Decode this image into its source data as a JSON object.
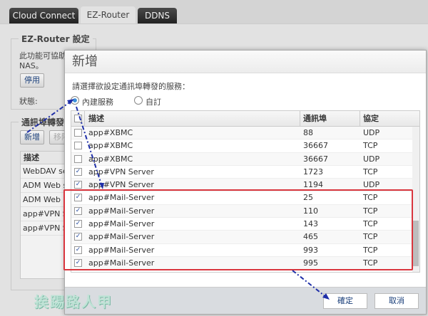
{
  "tabs": [
    {
      "label": "Cloud Connect"
    },
    {
      "label": "EZ-Router"
    },
    {
      "label": "DDNS"
    }
  ],
  "ez": {
    "legend": "EZ-Router 設定",
    "desc_line1": "此功能可協助",
    "desc_line2": "NAS。",
    "disable_button": "停用",
    "status_label": "狀態:"
  },
  "forward": {
    "legend": "通訊埠轉發",
    "add_button": "新增",
    "remove_button": "移除",
    "header": "描述",
    "rows": [
      "WebDAV ser",
      "ADM Web se",
      "ADM Web se",
      "app#VPN Se",
      "app#VPN Se"
    ]
  },
  "dialog": {
    "title": "新增",
    "prompt": "請選擇欲設定通訊埠轉發的服務：",
    "radio_builtin": "內建服務",
    "radio_custom": "自訂",
    "columns": {
      "desc": "描述",
      "port": "通訊埠",
      "protocol": "協定"
    },
    "rows": [
      {
        "desc": "app#XBMC",
        "port": "88",
        "protocol": "UDP",
        "checked": false
      },
      {
        "desc": "app#XBMC",
        "port": "36667",
        "protocol": "TCP",
        "checked": false
      },
      {
        "desc": "app#XBMC",
        "port": "36667",
        "protocol": "UDP",
        "checked": false
      },
      {
        "desc": "app#VPN Server",
        "port": "1723",
        "protocol": "TCP",
        "checked": true
      },
      {
        "desc": "app#VPN Server",
        "port": "1194",
        "protocol": "UDP",
        "checked": true
      },
      {
        "desc": "app#Mail-Server",
        "port": "25",
        "protocol": "TCP",
        "checked": true
      },
      {
        "desc": "app#Mail-Server",
        "port": "110",
        "protocol": "TCP",
        "checked": true
      },
      {
        "desc": "app#Mail-Server",
        "port": "143",
        "protocol": "TCP",
        "checked": true
      },
      {
        "desc": "app#Mail-Server",
        "port": "465",
        "protocol": "TCP",
        "checked": true
      },
      {
        "desc": "app#Mail-Server",
        "port": "993",
        "protocol": "TCP",
        "checked": true
      },
      {
        "desc": "app#Mail-Server",
        "port": "995",
        "protocol": "TCP",
        "checked": true
      }
    ],
    "ok_button": "確定",
    "cancel_button": "取消"
  },
  "watermark": "挨踢路人甲",
  "colors": {
    "highlight": "#d9363e",
    "arrow": "#1f2fa8"
  }
}
